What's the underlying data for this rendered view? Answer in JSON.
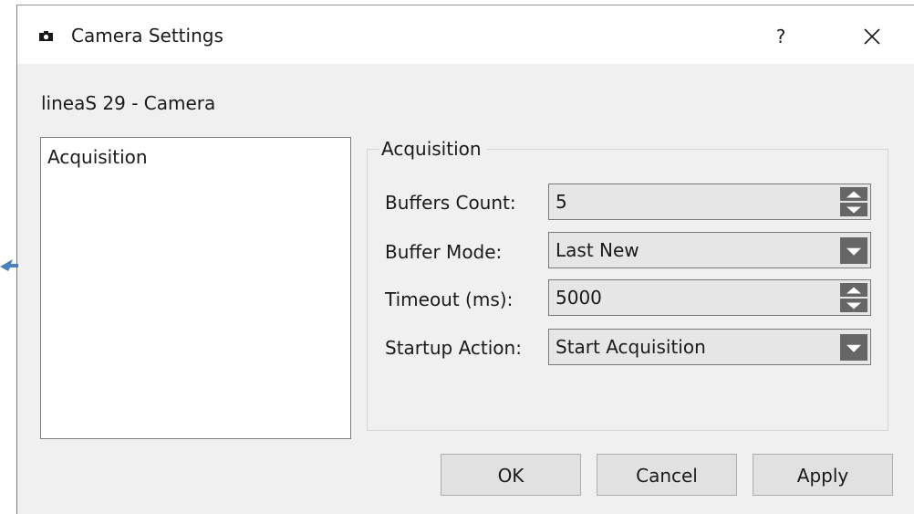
{
  "window": {
    "title": "Camera Settings",
    "help_label": "?",
    "icon": "camera-icon",
    "close_icon": "close-icon"
  },
  "device_label": "lineaS 29 - Camera",
  "tree": {
    "items": [
      {
        "label": "Acquisition"
      }
    ]
  },
  "acquisition": {
    "group_title": "Acquisition",
    "buffers_count": {
      "label": "Buffers Count:",
      "value": "5"
    },
    "buffer_mode": {
      "label": "Buffer Mode:",
      "value": "Last New"
    },
    "timeout": {
      "label": "Timeout (ms):",
      "value": "5000"
    },
    "startup_action": {
      "label": "Startup Action:",
      "value": "Start Acquisition"
    }
  },
  "buttons": {
    "ok": "OK",
    "cancel": "Cancel",
    "apply": "Apply"
  },
  "colors": {
    "client_bg": "#f0f0f0",
    "field_bg": "#e6e6e6",
    "spin_button": "#666666",
    "cursor_blue": "#4a7fc1"
  }
}
